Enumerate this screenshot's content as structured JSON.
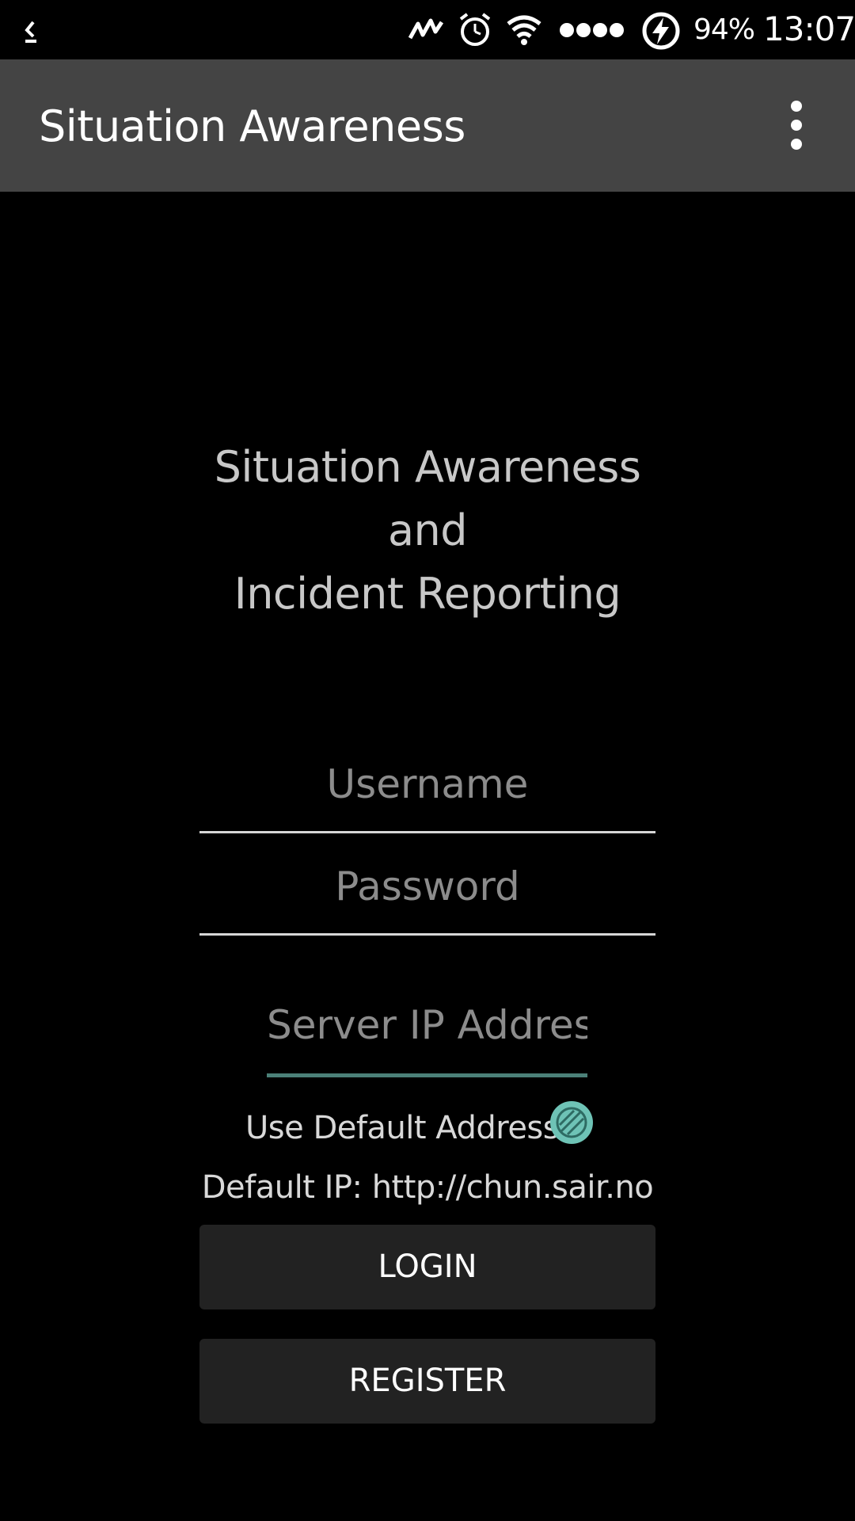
{
  "status_bar": {
    "battery": "94%",
    "time": "13:07",
    "icons": [
      "back-icon",
      "activity-icon",
      "alarm-icon",
      "wifi-icon",
      "signal-icon",
      "charging-icon"
    ]
  },
  "app_bar": {
    "title": "Situation Awareness",
    "menu_icon": "overflow-menu-icon"
  },
  "heading": {
    "line1": "Situation Awareness",
    "line2": "and",
    "line3": "Incident Reporting"
  },
  "form": {
    "username": {
      "placeholder": "Username",
      "value": ""
    },
    "password": {
      "placeholder": "Password",
      "value": ""
    },
    "server_ip": {
      "placeholder": "Server IP Address",
      "value": ""
    },
    "use_default_label": "Use Default Address",
    "default_ip_text": "Default IP: http://chun.sair.no",
    "login_label": "LOGIN",
    "register_label": "REGISTER"
  },
  "colors": {
    "background": "#000000",
    "app_bar": "#444444",
    "accent": "#4b8078",
    "radio": "#6ec3b6",
    "button": "#222222"
  }
}
